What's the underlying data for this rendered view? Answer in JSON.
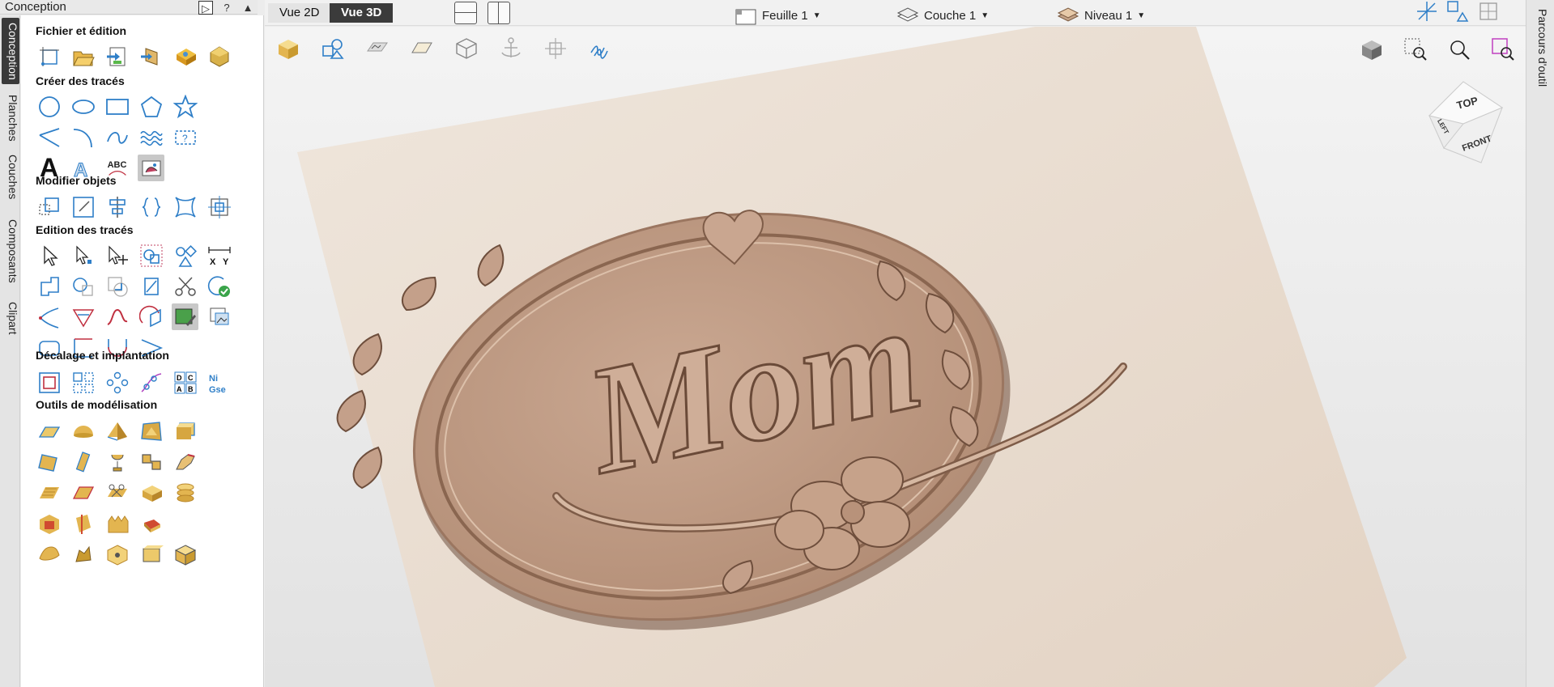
{
  "panel": {
    "title": "Conception",
    "pin_label": "?"
  },
  "left_tabs": [
    {
      "label": "Conception",
      "active": true
    },
    {
      "label": "Planches"
    },
    {
      "label": "Couches"
    },
    {
      "label": "Composants"
    },
    {
      "label": "Clipart"
    }
  ],
  "right_tabs": [
    {
      "label": "Parcours d'outil"
    }
  ],
  "sections": {
    "file": "Fichier et édition",
    "create": "Créer des tracés",
    "modify": "Modifier objets",
    "edit": "Edition des tracés",
    "offset": "Décalage et implantation",
    "model": "Outils de modélisation"
  },
  "toolbar": {
    "vue2d": "Vue 2D",
    "vue3d": "Vue 3D",
    "sheet": "Feuille 1",
    "layer": "Couche 1",
    "level": "Niveau 1"
  },
  "text_tools": {
    "big_a": "A",
    "abc": "ABC"
  },
  "cube": {
    "top": "TOP",
    "front": "FRONT",
    "left": "LEFT"
  },
  "colors": {
    "accent": "#2f7fc8",
    "wood": "#c5a489",
    "dark": "#3b3b3b"
  }
}
